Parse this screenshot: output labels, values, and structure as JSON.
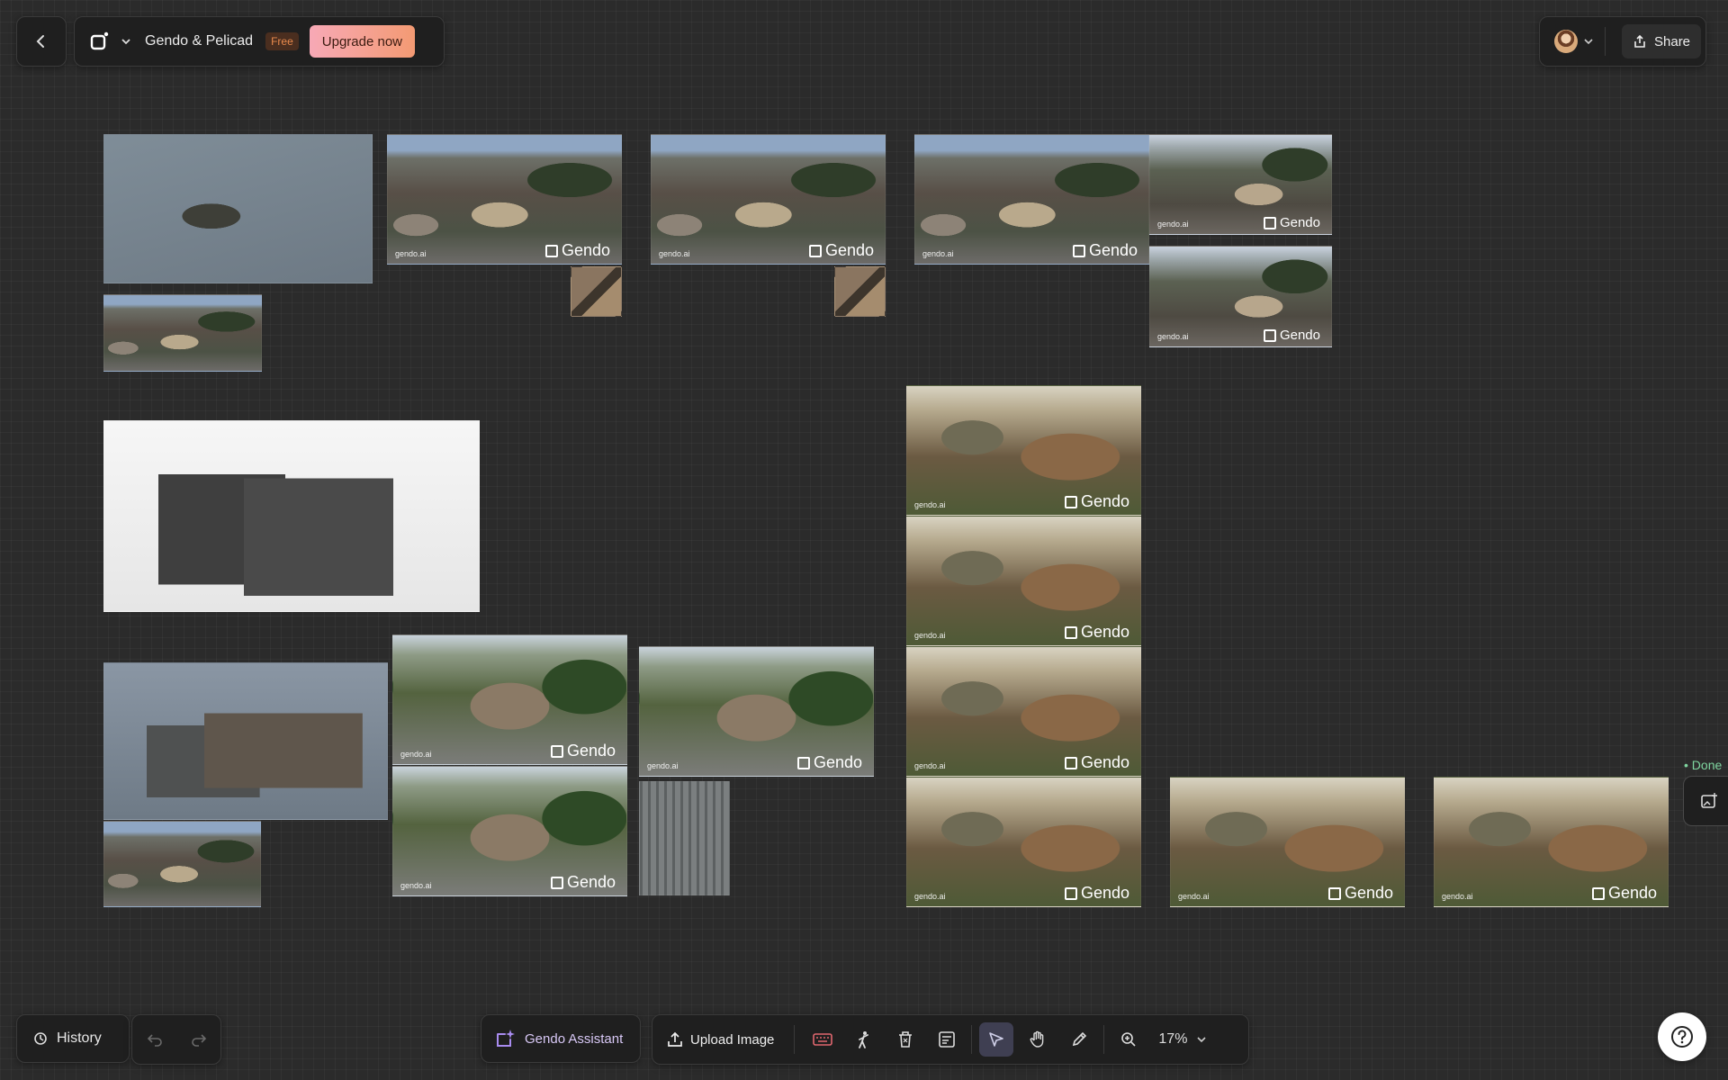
{
  "header": {
    "project_name": "Gendo & Pelicad",
    "plan_badge": "Free",
    "upgrade_label": "Upgrade now",
    "share_label": "Share"
  },
  "footer": {
    "history_label": "History",
    "assistant_label": "Gendo Assistant",
    "upload_label": "Upload Image",
    "zoom_label": "17%"
  },
  "canvas": {
    "watermark_small": "gendo.ai",
    "watermark_brand": "Gendo",
    "status_label": "• Done"
  },
  "icons": [
    "chevron-left-icon",
    "gendo-logo-icon",
    "chevron-down-icon",
    "share-icon",
    "history-icon",
    "undo-icon",
    "redo-icon",
    "sparkle-image-icon",
    "upload-icon",
    "keyboard-icon",
    "person-icon",
    "delete-icon",
    "notes-icon",
    "cursor-icon",
    "hand-icon",
    "pencil-icon",
    "zoom-icon",
    "help-icon",
    "image-generate-icon"
  ],
  "colors": {
    "background": "#2b2b2b",
    "panel": "#1f1f1f",
    "accent_gradient": [
      "#f7a9b6",
      "#f39a73"
    ],
    "done": "#7fd6a0"
  }
}
